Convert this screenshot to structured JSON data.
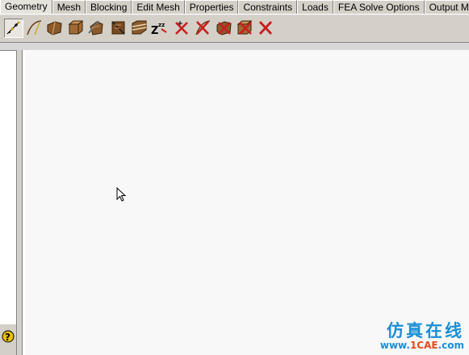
{
  "tabs": [
    {
      "label": "Geometry",
      "active": true
    },
    {
      "label": "Mesh"
    },
    {
      "label": "Blocking"
    },
    {
      "label": "Edit Mesh"
    },
    {
      "label": "Properties"
    },
    {
      "label": "Constraints"
    },
    {
      "label": "Loads"
    },
    {
      "label": "FEA Solve Options"
    },
    {
      "label": "Output Mesh"
    }
  ],
  "toolbar": {
    "tools": [
      {
        "icon": "create-point-icon",
        "selected": true
      },
      {
        "icon": "create-curve-icon"
      },
      {
        "icon": "create-surface-icon"
      },
      {
        "icon": "create-body-icon"
      },
      {
        "icon": "repair-geometry-icon"
      },
      {
        "icon": "transform-geometry-icon"
      },
      {
        "icon": "restore-dormant-icon"
      },
      {
        "icon": "sleep-dormant-icon"
      },
      {
        "icon": "delete-point-icon"
      },
      {
        "icon": "delete-curve-icon"
      },
      {
        "icon": "delete-surface-icon"
      },
      {
        "icon": "delete-body-icon"
      },
      {
        "icon": "delete-any-entity-icon"
      }
    ]
  },
  "left_panel": {
    "help_label": "?"
  },
  "watermark": {
    "cn": "仿真在线",
    "url_prefix": "www.",
    "url_brand": "1CAE",
    "url_suffix": ".com"
  },
  "colors": {
    "watermark_blue": "#1a8fd6",
    "watermark_red": "#e44a1f",
    "delete_red": "#c81e1e",
    "wood": "#8b5a2b"
  }
}
